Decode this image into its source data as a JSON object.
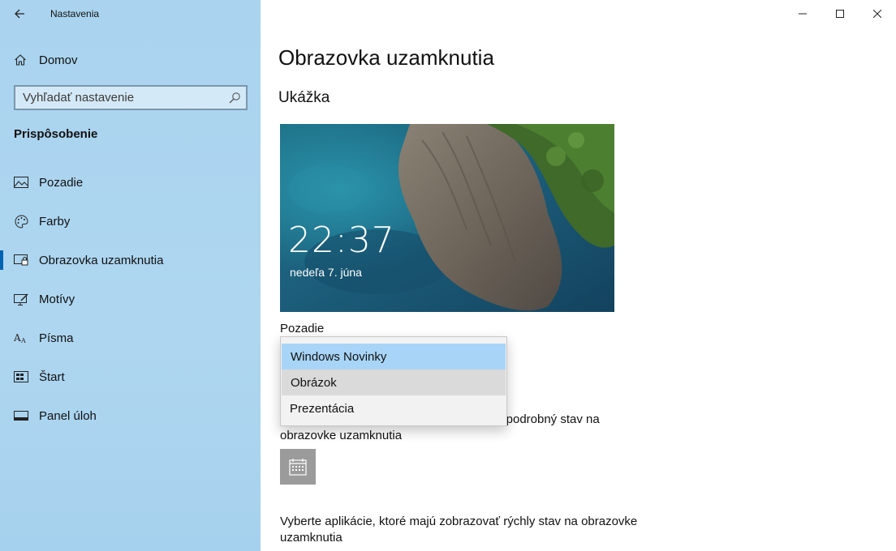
{
  "window": {
    "app_title": "Nastavenia",
    "controls": [
      "minimize",
      "maximize",
      "close"
    ]
  },
  "sidebar": {
    "home_label": "Domov",
    "search_placeholder": "Vyhľadať nastavenie",
    "section_title": "Prispôsobenie",
    "items": [
      {
        "label": "Pozadie",
        "icon": "picture-icon"
      },
      {
        "label": "Farby",
        "icon": "palette-icon"
      },
      {
        "label": "Obrazovka uzamknutia",
        "icon": "lock-screen-icon",
        "active": true
      },
      {
        "label": "Motívy",
        "icon": "themes-icon"
      },
      {
        "label": "Písma",
        "icon": "fonts-icon"
      },
      {
        "label": "Štart",
        "icon": "start-icon"
      },
      {
        "label": "Panel úloh",
        "icon": "taskbar-icon"
      }
    ]
  },
  "main": {
    "page_title": "Obrazovka uzamknutia",
    "preview_heading": "Ukážka",
    "preview": {
      "time": "22:37",
      "date": "nedeľa 7. júna"
    },
    "background_label": "Pozadie",
    "detail_status_text_visible": "vať podrobný stav na",
    "detail_status_text_line2": "obrazovke uzamknutia",
    "quick_status_text_line1": "Vyberte aplikácie, ktoré majú zobrazovať rýchly stav na obrazovke",
    "quick_status_text_line2": "uzamknutia"
  },
  "dropdown": {
    "options": [
      {
        "label": "Windows Novinky",
        "state": "selected"
      },
      {
        "label": "Obrázok",
        "state": "hover"
      },
      {
        "label": "Prezentácia",
        "state": "normal"
      }
    ]
  },
  "colors": {
    "sidebar_bg": "#aed6f0",
    "accent": "#0063b1",
    "dropdown_selected": "#a8d5f7"
  }
}
